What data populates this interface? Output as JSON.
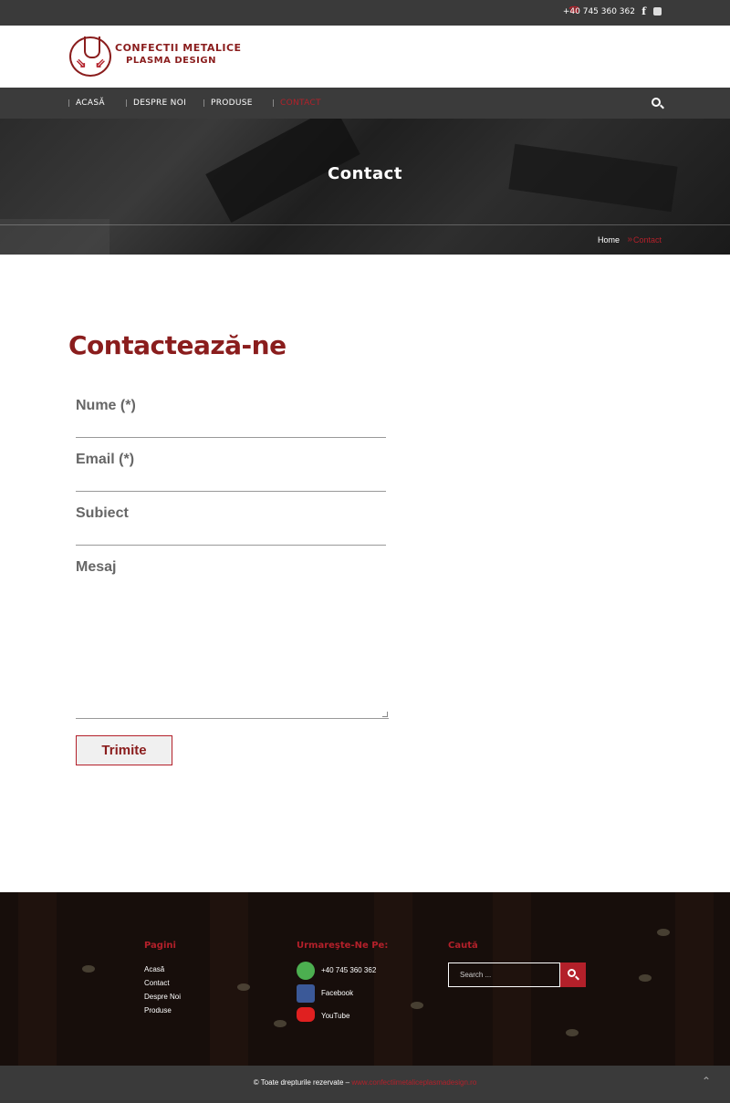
{
  "topbar": {
    "phone": "+40 745 360 362",
    "phone_icon": "phone-icon",
    "facebook_icon": "f",
    "youtube_icon": "youtube-icon"
  },
  "logo": {
    "line1": "CONFECTII METALICE",
    "line2": "PLASMA DESIGN"
  },
  "nav": {
    "items": [
      {
        "label": "ACASĂ"
      },
      {
        "label": "DESPRE NOI"
      },
      {
        "label": "PRODUSE"
      },
      {
        "label": "CONTACT"
      }
    ],
    "active": "CONTACT"
  },
  "hero": {
    "title": "Contact",
    "breadcrumb_home": "Home",
    "breadcrumb_sep": "»",
    "breadcrumb_current": "Contact"
  },
  "contact": {
    "title": "Contactează-ne",
    "fields": {
      "name": "Nume (*)",
      "email": "Email (*)",
      "subject": "Subiect",
      "message": "Mesaj"
    },
    "submit": "Trimite"
  },
  "footer": {
    "col1_title": "Pagini",
    "col1_links": [
      "Acasă",
      "Contact",
      "Despre Noi",
      "Produse"
    ],
    "col2_title": "Urmareşte-Ne Pe:",
    "social": [
      {
        "label": "+40 745 360 362",
        "icon": "whatsapp-icon"
      },
      {
        "label": "Facebook",
        "icon": "facebook-icon"
      },
      {
        "label": "YouTube",
        "icon": "youtube-icon"
      }
    ],
    "col3_title": "Caută",
    "search_placeholder": "Search ..."
  },
  "bottom": {
    "copyright": "© Toate drepturile rezervate – ",
    "copyright_link": "www.confectiimetaliceplasmadesign.ro"
  },
  "colors": {
    "accent": "#b3202a",
    "brand_dark": "#8a1d1d",
    "bar": "#3a3a3a"
  }
}
